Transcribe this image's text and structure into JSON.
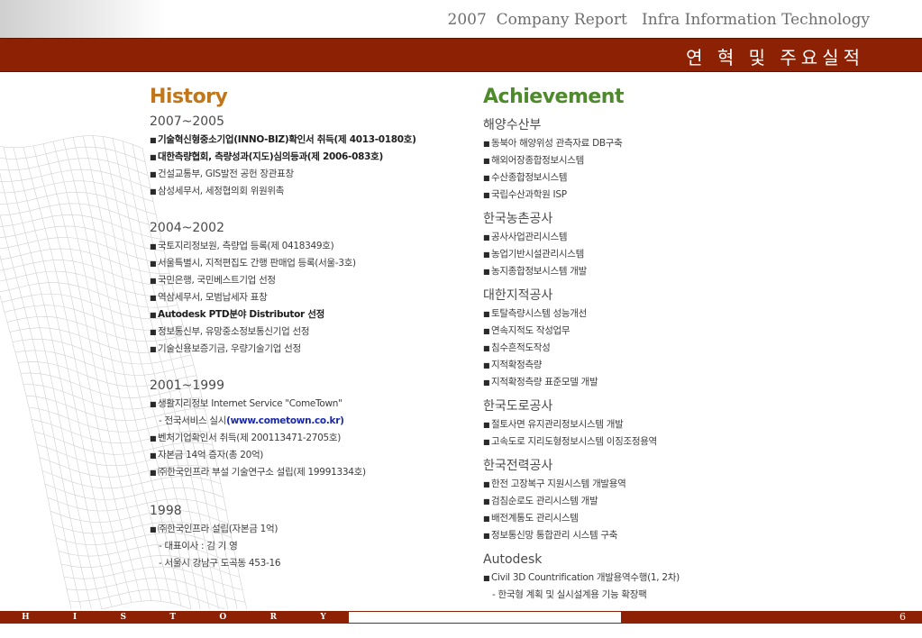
{
  "header": {
    "report_title": "2007  Company Report   Infra Information Technology",
    "section_title": "연 혁 및 주요실적"
  },
  "history": {
    "heading": "History",
    "periods": [
      {
        "label": "2007~2005",
        "items": [
          "기술혁신형중소기업(INNO-BIZ)확인서 취득(제 4013-0180호)",
          "대한측량협회, 측량성과(지도)심의등과(제 2006-083호)",
          "건설교통부, GIS발전 공헌 장관표창",
          "삼성세무서, 세정협의회 위원위촉"
        ]
      },
      {
        "label": "2004~2002",
        "items": [
          "국토지리정보원, 측량업 등록(제 0418349호)",
          "서울특별시, 지적편집도 간행 판매업 등록(서울-3호)",
          "국민은행, 국민베스트기업 선정",
          "역삼세무서, 모범납세자 표창",
          "Autodesk PTD분야 Distributor 선정",
          "정보통신부, 유망중소정보통신기업 선정",
          "기술신용보증기금, 우량기술기업 선정"
        ]
      },
      {
        "label": "2001~1999",
        "items": [
          "생활지리정보 Internet Service   \"ComeTown\"",
          "- 전국서비스 실시",
          "(www.cometown.co.kr)",
          "벤처기업확인서 취득(제 200113471-2705호)",
          "자본금 14억 증자(총 20억)",
          "㈜한국인프라 부설 기술연구소 설립(제 19991334호)"
        ]
      },
      {
        "label": "1998",
        "items": [
          "㈜한국인프라 설립(자본금 1억)",
          "- 대표이사 : 김 기 영",
          "- 서울시 강남구 도곡동 453-16"
        ]
      }
    ]
  },
  "achievement": {
    "heading": "Achievement",
    "orgs": [
      {
        "name": "해양수산부",
        "items": [
          "동북아 해양위성 관측자료 DB구축",
          "해외어장종합정보시스템",
          "수산종합정보시스템",
          "국립수산과학원 ISP"
        ]
      },
      {
        "name": "한국농촌공사",
        "items": [
          "공사사업관리시스템",
          "농업기반시설관리시스템",
          "농지종합정보시스템 개발"
        ]
      },
      {
        "name": "대한지적공사",
        "items": [
          "토탈측량시스템 성능개선",
          "연속지적도 작성업무",
          "침수흔적도작성",
          "지적확정측량",
          "지적확정측량 표준모델 개발"
        ]
      },
      {
        "name": "한국도로공사",
        "items": [
          "절토사면 유지관리정보시스템 개발",
          "고속도로 지리도형정보시스템 이징조정용역"
        ]
      },
      {
        "name": "한국전력공사",
        "items": [
          "한전 고장복구 지원시스템 개발용역",
          "검침순로도 관리시스템 개발",
          "배전계통도 관리시스템",
          "정보통신망 통합관리 시스템 구축"
        ]
      },
      {
        "name": "Autodesk",
        "items": [
          "Civil 3D Countrification 개발용역수행(1, 2차)",
          "- 한국형 계획 및 실시설계용 기능 확장팩"
        ]
      }
    ]
  },
  "footer": {
    "letters": [
      "H",
      "I",
      "S",
      "T",
      "O",
      "R",
      "Y"
    ],
    "page_number": "6"
  },
  "colors": {
    "brand_bar": "#8c2104",
    "history_heading": "#c0761a",
    "achievement_heading": "#4e8a2c",
    "link": "#1a2aa8"
  }
}
